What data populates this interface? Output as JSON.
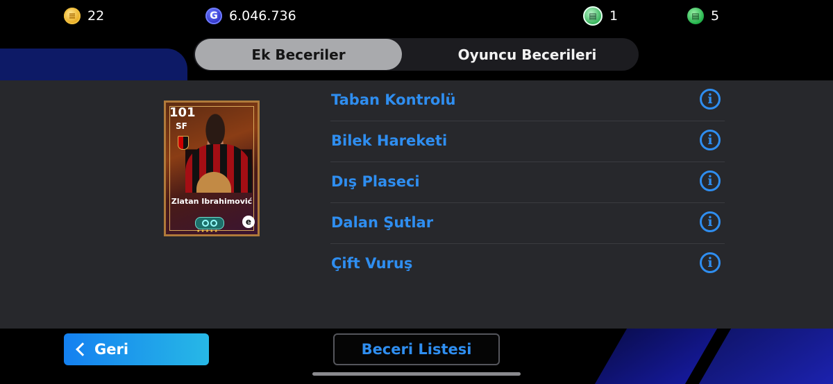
{
  "currencies": {
    "coins": {
      "icon": "coin-icon",
      "value": "22"
    },
    "gp": {
      "icon": "gp-icon",
      "value": "6.046.736"
    },
    "ticket_a": {
      "icon": "ticket-icon",
      "value": "1"
    },
    "ticket_b": {
      "icon": "ticket-icon",
      "value": "5"
    }
  },
  "tabs": [
    {
      "label": "Ek Beceriler",
      "active": true
    },
    {
      "label": "Oyuncu Becerileri",
      "active": false
    }
  ],
  "player_card": {
    "rating": "101",
    "position": "SF",
    "name": "Zlatan Ibrahimović"
  },
  "skills": [
    {
      "name": "Taban Kontrolü"
    },
    {
      "name": "Bilek Hareketi"
    },
    {
      "name": "Dış Plaseci"
    },
    {
      "name": "Dalan Şutlar"
    },
    {
      "name": "Çift Vuruş"
    }
  ],
  "buttons": {
    "back": "Geri",
    "skill_list": "Beceri Listesi"
  },
  "colors": {
    "accent_blue": "#2f8ef0",
    "panel_bg": "#27282c"
  }
}
